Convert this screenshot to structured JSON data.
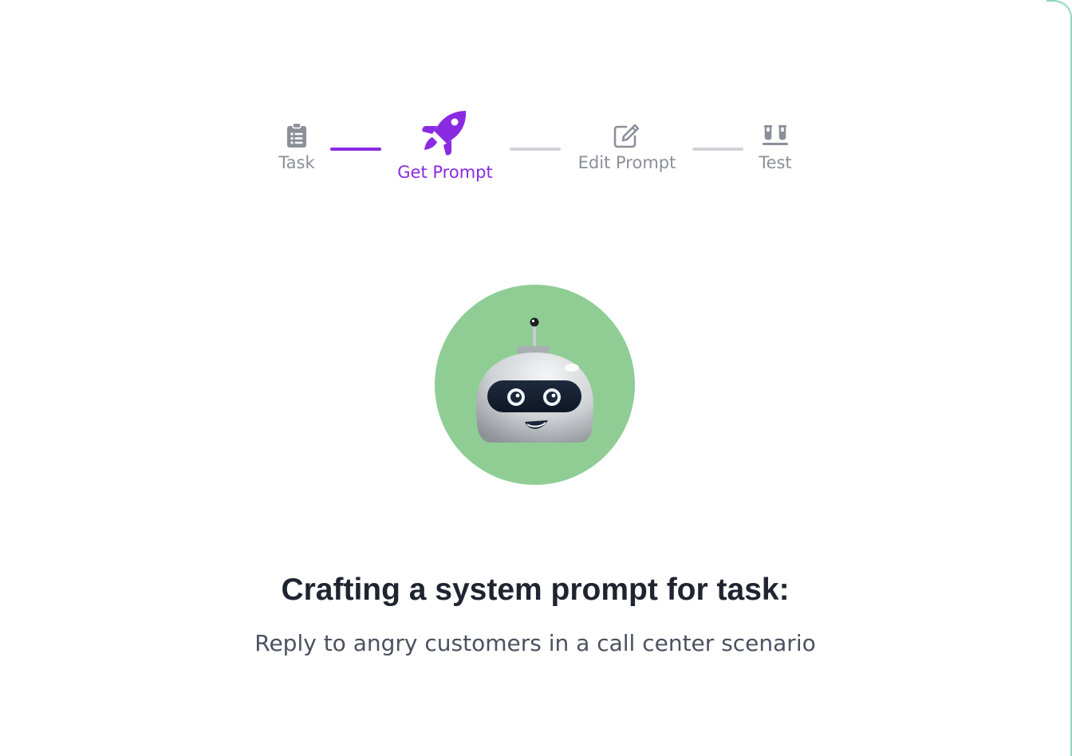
{
  "stepper": {
    "steps": [
      {
        "label": "Task",
        "icon": "clipboard-list-icon",
        "state": "completed"
      },
      {
        "label": "Get Prompt",
        "icon": "rocket-icon",
        "state": "active"
      },
      {
        "label": "Edit Prompt",
        "icon": "pencil-square-icon",
        "state": "pending"
      },
      {
        "label": "Test",
        "icon": "test-tubes-icon",
        "state": "pending"
      }
    ]
  },
  "main": {
    "headline": "Crafting a system prompt for task:",
    "task_description": "Reply to angry customers in a call center scenario",
    "avatar_icon": "robot-icon"
  },
  "colors": {
    "accent": "#8a2be2",
    "inactive": "#8b8f99",
    "connector_inactive": "#d1d3d8",
    "avatar_bg": "#90cd95",
    "frame_border": "#8fd6bf"
  }
}
